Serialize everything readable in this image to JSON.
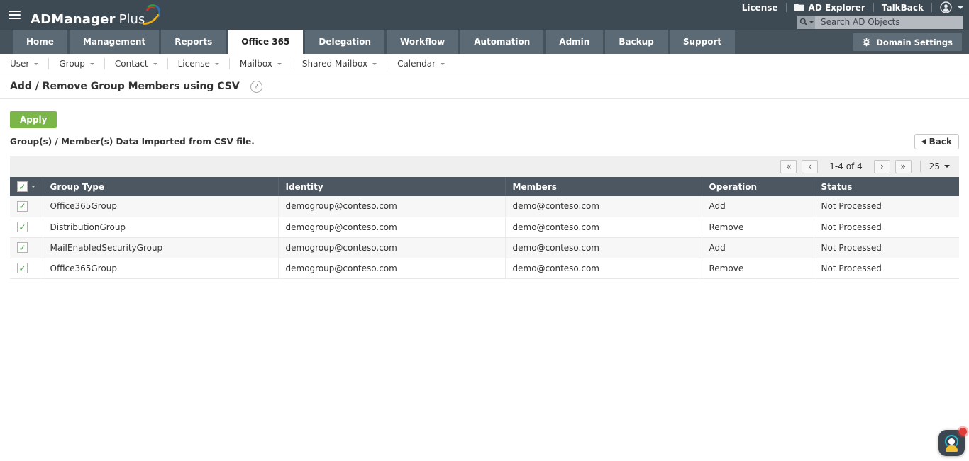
{
  "app": {
    "brand_primary": "ADManager",
    "brand_secondary": "Plus",
    "header_links": [
      {
        "label": "License"
      },
      {
        "label": "AD Explorer",
        "icon": "folder-icon"
      },
      {
        "label": "TalkBack"
      }
    ],
    "user_menu_icon": "user-icon",
    "search": {
      "placeholder": "Search AD Objects",
      "icon": "search-icon"
    }
  },
  "nav": {
    "tabs": [
      "Home",
      "Management",
      "Reports",
      "Office 365",
      "Delegation",
      "Workflow",
      "Automation",
      "Admin",
      "Backup",
      "Support"
    ],
    "active_tab": "Office 365",
    "domain_settings": {
      "label": "Domain Settings",
      "icon": "gear-icon"
    }
  },
  "submenu": {
    "items": [
      "User",
      "Group",
      "Contact",
      "License",
      "Mailbox",
      "Shared Mailbox",
      "Calendar"
    ]
  },
  "page": {
    "title": "Add / Remove Group Members using CSV",
    "help_glyph": "?",
    "apply_button": "Apply",
    "section_heading": "Group(s) / Member(s) Data Imported from CSV file.",
    "back_button": "Back"
  },
  "pagination": {
    "first_glyph": "«",
    "prev_glyph": "‹",
    "range_text": "1-4 of 4",
    "next_glyph": "›",
    "last_glyph": "»",
    "page_size": "25"
  },
  "table": {
    "check_glyph": "✓",
    "columns": [
      "Group Type",
      "Identity",
      "Members",
      "Operation",
      "Status"
    ],
    "rows": [
      {
        "checked": true,
        "group_type": "Office365Group",
        "identity": "demogroup@conteso.com",
        "members": "demo@conteso.com",
        "operation": "Add",
        "status": "Not Processed"
      },
      {
        "checked": true,
        "group_type": "DistributionGroup",
        "identity": "demogroup@conteso.com",
        "members": "demo@conteso.com",
        "operation": "Remove",
        "status": "Not Processed"
      },
      {
        "checked": true,
        "group_type": "MailEnabledSecurityGroup",
        "identity": "demogroup@conteso.com",
        "members": "demo@conteso.com",
        "operation": "Add",
        "status": "Not Processed"
      },
      {
        "checked": true,
        "group_type": "Office365Group",
        "identity": "demogroup@conteso.com",
        "members": "demo@conteso.com",
        "operation": "Remove",
        "status": "Not Processed"
      }
    ]
  },
  "colors": {
    "header_bg": "#3e4a53",
    "tabbar_bg": "#47535c",
    "tab_bg": "#5b6a74",
    "active_tab_bg": "#ffffff",
    "accent_green": "#7ab648",
    "table_header_bg": "#4d5761",
    "check_green": "#3fa23f",
    "pagination_bg": "#efefef",
    "chat_teal": "#29b6c8",
    "chat_yellow": "#efc233",
    "badge_red": "#e23c39"
  }
}
